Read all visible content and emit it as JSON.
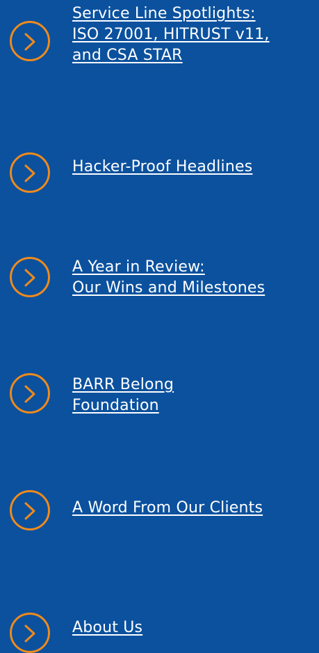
{
  "accent_color": "#ef8a1c",
  "background_color": "#0b519e",
  "nav": {
    "items": [
      {
        "icon": "chevron-right-circle-icon",
        "lines": [
          "Service Line Spotlights:",
          "ISO 27001, HITRUST v11,",
          "and CSA STAR"
        ]
      },
      {
        "icon": "chevron-right-circle-icon",
        "lines": [
          "Hacker-Proof Headlines"
        ]
      },
      {
        "icon": "chevron-right-circle-icon",
        "lines": [
          "A Year in Review:",
          "Our Wins and Milestones"
        ]
      },
      {
        "icon": "chevron-right-circle-icon",
        "lines": [
          "BARR Belong",
          "Foundation"
        ]
      },
      {
        "icon": "chevron-right-circle-icon",
        "lines": [
          "A Word From Our Clients"
        ]
      },
      {
        "icon": "chevron-right-circle-icon",
        "lines": [
          "About Us"
        ]
      }
    ]
  }
}
